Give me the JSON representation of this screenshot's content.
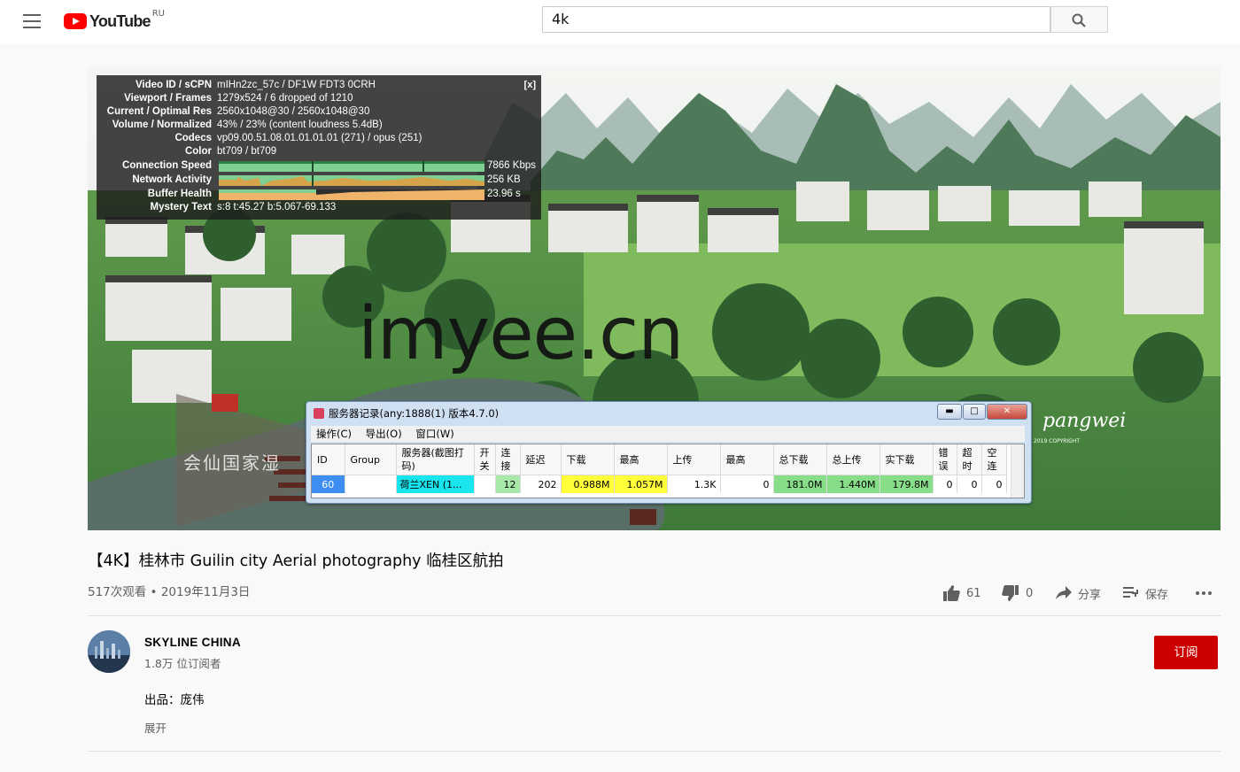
{
  "header": {
    "logo_text": "YouTube",
    "country_code": "RU",
    "search_value": "4k"
  },
  "stats": {
    "rows": [
      {
        "label": "Video ID / sCPN",
        "value": "mIHn2zc_57c / DF1W FDT3 0CRH"
      },
      {
        "label": "Viewport / Frames",
        "value": "1279x524 / 6 dropped of 1210"
      },
      {
        "label": "Current / Optimal Res",
        "value": "2560x1048@30 / 2560x1048@30"
      },
      {
        "label": "Volume / Normalized",
        "value": "43% / 23% (content loudness 5.4dB)"
      },
      {
        "label": "Codecs",
        "value": "vp09.00.51.08.01.01.01.01 (271) / opus (251)"
      },
      {
        "label": "Color",
        "value": "bt709 / bt709"
      }
    ],
    "connection_speed": {
      "label": "Connection Speed",
      "value": "7866 Kbps"
    },
    "network_activity": {
      "label": "Network Activity",
      "value": "256 KB"
    },
    "buffer_health": {
      "label": "Buffer Health",
      "value": "23.96 s"
    },
    "mystery": {
      "label": "Mystery Text",
      "value": "s:8 t:45.27 b:5.067-69.133"
    },
    "close_label": "[x]"
  },
  "overlay": {
    "watermark": "imyee.cn",
    "signature": "pangwei",
    "signature_sub": "2019 COPYRIGHT",
    "sign_text": "会仙国家湿"
  },
  "server_window": {
    "title": "服务器记录(any:1888(1) 版本4.7.0)",
    "buttons": {
      "minimize": "▬",
      "maximize": "□",
      "close": "✕"
    },
    "menu": [
      "操作(C)",
      "导出(O)",
      "窗口(W)"
    ],
    "columns": [
      "ID",
      "Group",
      "服务器(截图打码)",
      "开关",
      "连接",
      "延迟",
      "下载",
      "最高",
      "上传",
      "最高",
      "总下载",
      "总上传",
      "实下载",
      "错误",
      "超时",
      "空连"
    ],
    "row": [
      "60",
      "",
      "荷兰XEN (1...",
      "",
      "12",
      "202",
      "0.988M",
      "1.057M",
      "1.3K",
      "0",
      "181.0M",
      "1.440M",
      "179.8M",
      "0",
      "0",
      "0"
    ],
    "cell_colors": [
      "#3d8ef0",
      "#ffffff",
      "#19e5ef",
      "#ffffff",
      "#a8e8a8",
      "#ffffff",
      "#ffff3a",
      "#ffff3a",
      "#ffffff",
      "#ffffff",
      "#88dd88",
      "#88dd88",
      "#88dd88",
      "#ffffff",
      "#ffffff",
      "#ffffff"
    ]
  },
  "video": {
    "title": "【4K】桂林市 Guilin city Aerial photography 临桂区航拍",
    "views_date": "517次观看 • 2019年11月3日",
    "likes": "61",
    "dislikes": "0",
    "share_label": "分享",
    "save_label": "保存"
  },
  "channel": {
    "name": "SKYLINE CHINA",
    "subscribers": "1.8万 位订阅者",
    "subscribe_label": "订阅",
    "description": "出品：庞伟",
    "show_more": "展开"
  },
  "colors": {
    "brand_red": "#ff0000",
    "subscribe_red": "#cc0000"
  }
}
